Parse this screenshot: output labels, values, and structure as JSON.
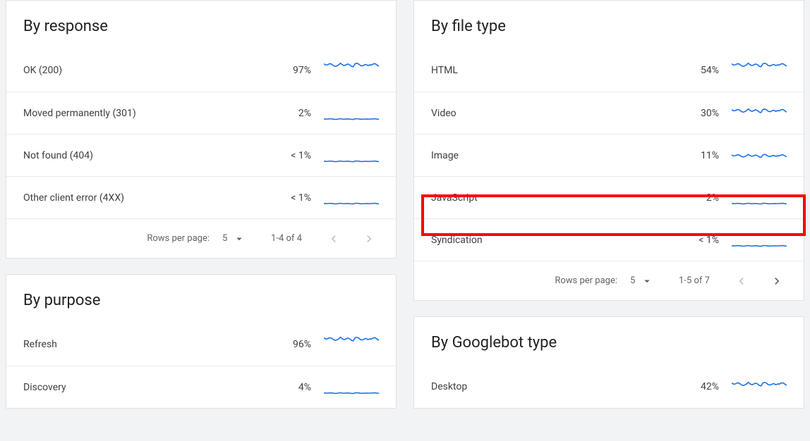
{
  "pager_labels": {
    "rows_per_page": "Rows per page:"
  },
  "cards": {
    "by_response": {
      "title": "By response",
      "rows": [
        {
          "label": "OK (200)",
          "pct": "97%",
          "level": "high"
        },
        {
          "label": "Moved permanently (301)",
          "pct": "2%",
          "level": "flat"
        },
        {
          "label": "Not found (404)",
          "pct": "< 1%",
          "level": "flat"
        },
        {
          "label": "Other client error (4XX)",
          "pct": "< 1%",
          "level": "flat"
        }
      ],
      "pager": {
        "rpp": "5",
        "range": "1-4 of 4",
        "prev_enabled": false,
        "next_enabled": false
      }
    },
    "by_purpose": {
      "title": "By purpose",
      "rows": [
        {
          "label": "Refresh",
          "pct": "96%",
          "level": "high"
        },
        {
          "label": "Discovery",
          "pct": "4%",
          "level": "flat"
        }
      ]
    },
    "by_file_type": {
      "title": "By file type",
      "rows": [
        {
          "label": "HTML",
          "pct": "54%",
          "level": "high",
          "highlight": false
        },
        {
          "label": "Video",
          "pct": "30%",
          "level": "mid",
          "highlight": false
        },
        {
          "label": "Image",
          "pct": "11%",
          "level": "low",
          "highlight": false
        },
        {
          "label": "JavaScript",
          "pct": "2%",
          "level": "flat",
          "highlight": true
        },
        {
          "label": "Syndication",
          "pct": "< 1%",
          "level": "flat",
          "highlight": false
        }
      ],
      "pager": {
        "rpp": "5",
        "range": "1-5 of 7",
        "prev_enabled": false,
        "next_enabled": true
      }
    },
    "by_googlebot_type": {
      "title": "By Googlebot type",
      "rows": [
        {
          "label": "Desktop",
          "pct": "42%",
          "level": "mid"
        }
      ]
    }
  }
}
